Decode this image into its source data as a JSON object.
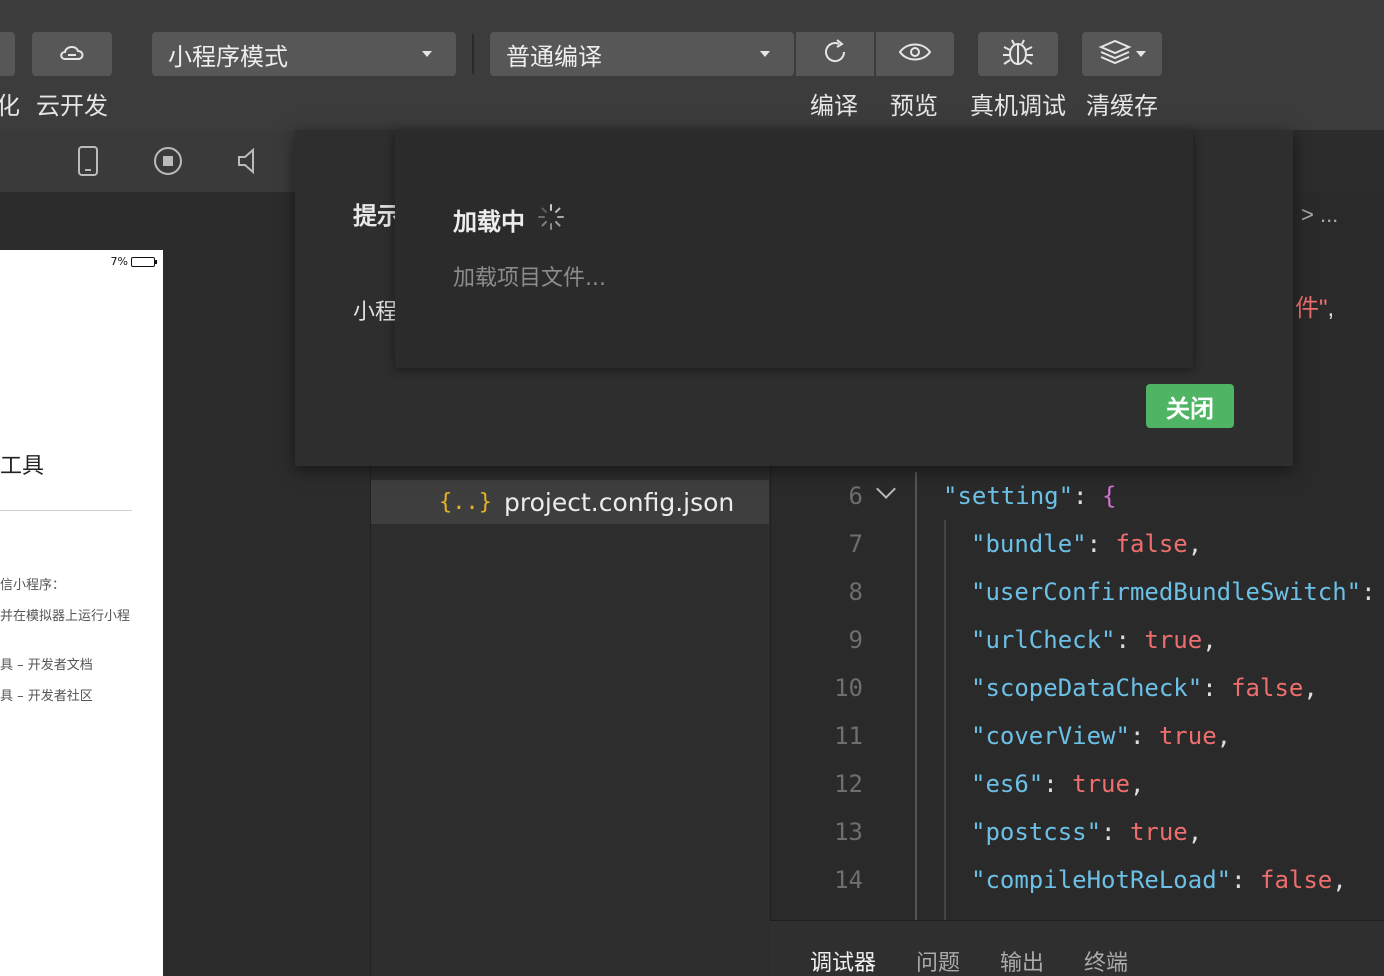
{
  "toolbar": {
    "cut_label": "化",
    "cloud_label": "云开发",
    "mode_select": "小程序模式",
    "compile_select": "普通编译",
    "compile_label": "编译",
    "preview_label": "预览",
    "remote_debug_label": "真机调试",
    "clear_cache_label": "清缓存"
  },
  "subbar": {
    "icons": [
      "phone-icon",
      "stop-icon",
      "volume-icon"
    ]
  },
  "simulator": {
    "battery": "7%",
    "title": "工具",
    "lines": [
      "信小程序：",
      "并在模拟器上运行小程",
      "具 – 开发者文档",
      "具 – 开发者社区"
    ]
  },
  "tree": {
    "selected_file": "project.config.json",
    "file_icon": "{..}"
  },
  "editor": {
    "breadcrumb_tail": "> ...",
    "fragment_text": "件\"",
    "fragment_comma": ",",
    "lines": [
      {
        "n": "6",
        "key": "\"setting\"",
        "val": "{"
      },
      {
        "n": "7",
        "key": "\"bundle\"",
        "val": "false"
      },
      {
        "n": "8",
        "key": "\"userConfirmedBundleSwitch\"",
        "val": ""
      },
      {
        "n": "9",
        "key": "\"urlCheck\"",
        "val": "true"
      },
      {
        "n": "10",
        "key": "\"scopeDataCheck\"",
        "val": "false"
      },
      {
        "n": "11",
        "key": "\"coverView\"",
        "val": "true"
      },
      {
        "n": "12",
        "key": "\"es6\"",
        "val": "true"
      },
      {
        "n": "13",
        "key": "\"postcss\"",
        "val": "true"
      },
      {
        "n": "14",
        "key": "\"compileHotReLoad\"",
        "val": "false"
      }
    ]
  },
  "bottom_tabs": [
    "调试器",
    "问题",
    "输出",
    "终端"
  ],
  "modal": {
    "title": "提示",
    "body": "小程",
    "close_label": "关闭"
  },
  "loader": {
    "title": "加载中",
    "subtitle": "加载项目文件..."
  },
  "colors": {
    "accent_green": "#4fb564",
    "json_key": "#6cc0e6",
    "json_value": "#ee6e6e"
  }
}
